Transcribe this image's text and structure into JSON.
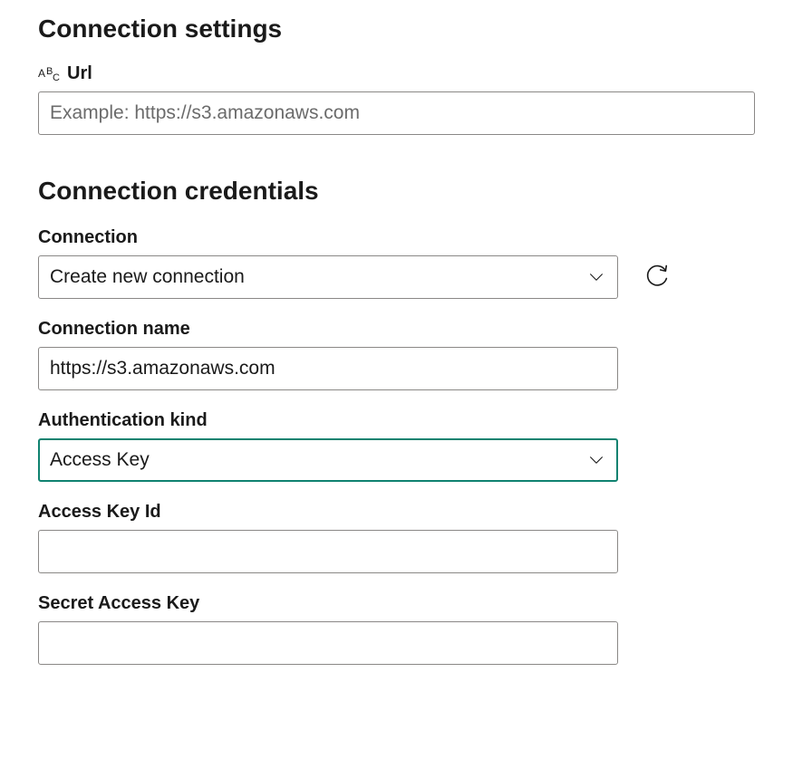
{
  "settings": {
    "heading": "Connection settings",
    "url_label": "Url",
    "url_placeholder": "Example: https://s3.amazonaws.com",
    "url_value": ""
  },
  "credentials": {
    "heading": "Connection credentials",
    "connection_label": "Connection",
    "connection_selected": "Create new connection",
    "connection_name_label": "Connection name",
    "connection_name_value": "https://s3.amazonaws.com",
    "auth_kind_label": "Authentication kind",
    "auth_kind_selected": "Access Key",
    "access_key_id_label": "Access Key Id",
    "access_key_id_value": "",
    "secret_key_label": "Secret Access Key",
    "secret_key_value": ""
  }
}
